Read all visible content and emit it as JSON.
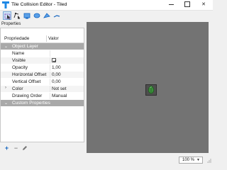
{
  "window": {
    "title": "Tile Collision Editor - Tiled",
    "minimize": "—",
    "close": "✕"
  },
  "toolbar": {
    "tools": [
      "select-objects",
      "edit-polygons",
      "insert-rectangle",
      "insert-ellipse",
      "insert-polygon",
      "insert-polyline"
    ]
  },
  "properties": {
    "dock_title": "Properties",
    "header": {
      "name": "Propriedade",
      "value": "Valor"
    },
    "groups": [
      {
        "label": "Object Layer",
        "rows": [
          {
            "name": "Name",
            "value": ""
          },
          {
            "name": "Visible",
            "value": "checked"
          },
          {
            "name": "Opacity",
            "value": "1,00"
          },
          {
            "name": "Horizontal Offset",
            "value": "0,00"
          },
          {
            "name": "Vertical Offset",
            "value": "0,00"
          },
          {
            "name": "Color",
            "value": "Not set"
          },
          {
            "name": "Drawing Order",
            "value": "Manual"
          }
        ]
      },
      {
        "label": "Custom Properties",
        "rows": []
      }
    ],
    "actions": {
      "add": "+",
      "remove": "−"
    }
  },
  "canvas": {
    "background": "#737373",
    "tile_icon": "green-leaf-tile-icon"
  },
  "status": {
    "zoom": "100 %"
  },
  "colors": {
    "accent": "#1565c0",
    "group_header": "#a9a9a9",
    "leaf": "#3b8f3b"
  }
}
